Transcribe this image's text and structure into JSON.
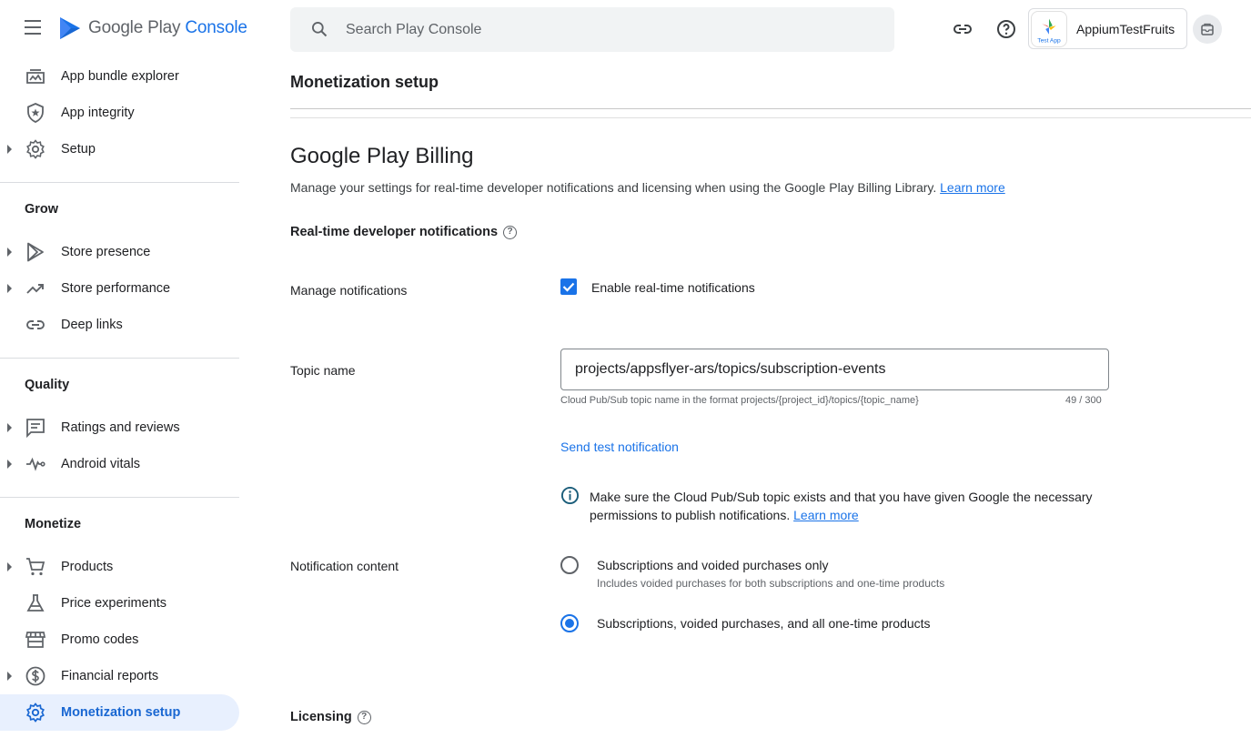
{
  "header": {
    "logo_text": "Google Play",
    "logo_console": "Console",
    "search_placeholder": "Search Play Console",
    "app_name": "AppiumTestFruits",
    "app_icon_text": "Test App"
  },
  "sidebar": {
    "items_top": [
      {
        "label": "App bundle explorer",
        "icon": "app-bundle-icon"
      },
      {
        "label": "App integrity",
        "icon": "shield-icon"
      },
      {
        "label": "Setup",
        "icon": "gear-icon"
      }
    ],
    "grow_title": "Grow",
    "grow_items": [
      {
        "label": "Store presence",
        "icon": "play-icon"
      },
      {
        "label": "Store performance",
        "icon": "trending-icon"
      },
      {
        "label": "Deep links",
        "icon": "link-icon"
      }
    ],
    "quality_title": "Quality",
    "quality_items": [
      {
        "label": "Ratings and reviews",
        "icon": "reviews-icon"
      },
      {
        "label": "Android vitals",
        "icon": "vitals-icon"
      }
    ],
    "monetize_title": "Monetize",
    "monetize_items": [
      {
        "label": "Products",
        "icon": "cart-icon"
      },
      {
        "label": "Price experiments",
        "icon": "flask-icon"
      },
      {
        "label": "Promo codes",
        "icon": "store-icon"
      },
      {
        "label": "Financial reports",
        "icon": "dollar-icon"
      },
      {
        "label": "Monetization setup",
        "icon": "gear-icon"
      }
    ]
  },
  "main": {
    "page_title": "Monetization setup",
    "heading": "Google Play Billing",
    "description": "Manage your settings for real-time developer notifications and licensing when using the Google Play Billing Library.",
    "learn_more": "Learn more",
    "rtdn_title": "Real-time developer notifications",
    "manage_label": "Manage notifications",
    "enable_label": "Enable real-time notifications",
    "topic_label": "Topic name",
    "topic_value": "projects/appsflyer-ars/topics/subscription-events",
    "topic_hint": "Cloud Pub/Sub topic name in the format projects/{project_id}/topics/{topic_name}",
    "topic_counter": "49 / 300",
    "send_test": "Send test notification",
    "info_text": "Make sure the Cloud Pub/Sub topic exists and that you have given Google the necessary permissions to publish notifications.",
    "info_learn_more": "Learn more",
    "content_label": "Notification content",
    "option1": "Subscriptions and voided purchases only",
    "option1_sub": "Includes voided purchases for both subscriptions and one-time products",
    "option2": "Subscriptions, voided purchases, and all one-time products",
    "licensing_title": "Licensing"
  },
  "colors": {
    "accent": "#1a73e8",
    "active_bg": "#e8f0fe"
  }
}
